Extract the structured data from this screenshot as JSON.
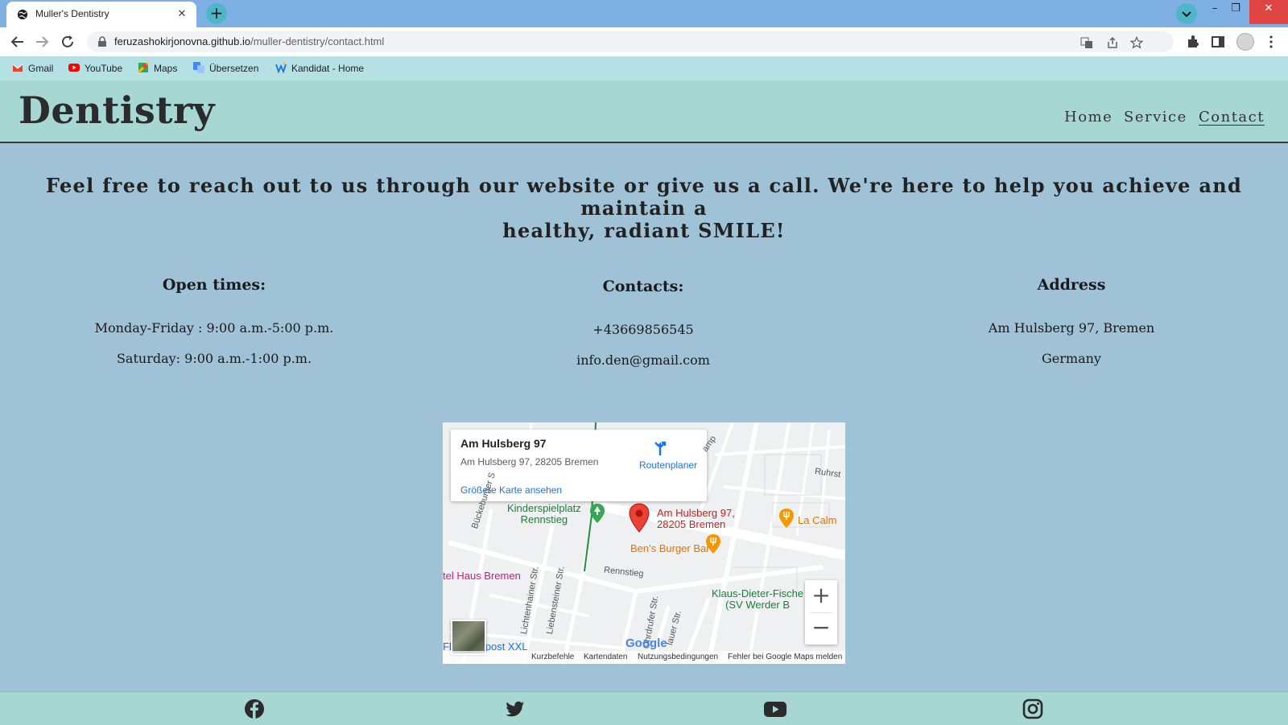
{
  "browser": {
    "tab_title": "Muller's Dentistry",
    "url_host": "feruzashokirjonovna.github.io",
    "url_path": "/muller-dentistry/contact.html",
    "bookmarks": [
      "Gmail",
      "YouTube",
      "Maps",
      "Übersetzen",
      "Kandidat - Home"
    ]
  },
  "site": {
    "logo": "Dentistry",
    "nav": [
      "Home",
      "Service",
      "Contact"
    ],
    "active_nav": "Contact",
    "intro_line1": "Feel free to reach out to us through our website or give us a call. We're here to help you achieve and maintain a",
    "intro_line2": "healthy, radiant SMILE!",
    "open_times": {
      "heading": "Open times:",
      "line1": "Monday-Friday : 9:00 a.m.-5:00 p.m.",
      "line2": "Saturday: 9:00 a.m.-1:00 p.m."
    },
    "contacts": {
      "heading": "Contacts:",
      "phone": "+43669856545",
      "email": "info.den@gmail.com"
    },
    "address": {
      "heading": "Address",
      "line1": "Am Hulsberg 97, Bremen",
      "line2": "Germany"
    }
  },
  "map": {
    "place_name": "Am Hulsberg 97",
    "place_address": "Am Hulsberg 97, 28205 Bremen",
    "directions_label": "Routenplaner",
    "larger_map_label": "Größere Karte ansehen",
    "marker_label_1": "Am Hulsberg 97,",
    "marker_label_2": "28205 Bremen",
    "poi_playground_1": "Kinderspielplatz",
    "poi_playground_2": "Rennstieg",
    "poi_burger": "Ben's Burger Bar",
    "poi_cafe": "La Calm",
    "poi_hotel": "tel Haus Bremen",
    "poi_club_1": "Klaus-Dieter-Fische",
    "poi_club_2": "(SV Werder B",
    "poi_flaschenpost": "Flaschenpost XXL",
    "street_rennstieg": "Rennstieg",
    "street_ruhrst": "Ruhrst",
    "street_bueckeburger": "Bückeburger S",
    "street_lichtenhainer": "Lichtenhainer Str.",
    "street_liebensteiner": "Liebensteiner Str.",
    "street_ohrdrufer": "Ohrdrufer Str.",
    "street_lauer": "lauer Str.",
    "street_kamp": "amp",
    "google": "Google",
    "attribution": [
      "Kurzbefehle",
      "Kartendaten",
      "Nutzungsbedingungen",
      "Fehler bei Google Maps melden"
    ],
    "zoom_in": "+",
    "zoom_out": "−"
  },
  "footer": {
    "icons": [
      "facebook-icon",
      "twitter-icon",
      "youtube-icon",
      "instagram-icon"
    ]
  }
}
